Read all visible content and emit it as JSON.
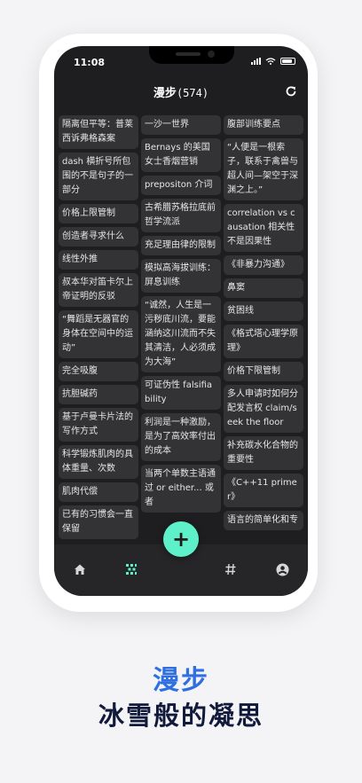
{
  "status": {
    "time": "11:08"
  },
  "header": {
    "title": "漫步",
    "count": "(574)"
  },
  "columns": [
    [
      "隔离但平等：普莱西诉弗格森案",
      "dash 横折号所包围的不是句子的一部分",
      "价格上限管制",
      "创造者寻求什么",
      "线性外推",
      "叔本华对笛卡尔上帝证明的反驳",
      "“舞蹈是无器官的身体在空间中的运动”",
      "完全吸腹",
      "抗胆碱药",
      "基于卢曼卡片法的写作方式",
      "科学锻炼肌肉的具体重量、次数",
      "肌肉代偿",
      "已有的习惯会一直保留"
    ],
    [
      "一沙一世界",
      "Bernays 的美国女士香烟营销",
      "prepositon 介词",
      "古希腊苏格拉底前哲学流派",
      "充足理由律的限制",
      "模拟高海拔训练：屏息训练",
      "“诚然，人生是一污秽底川流，要能涵纳这川流而不失其清洁，人必须成为大海”",
      "可证伪性 falsifiability",
      "利润是一种激励，是为了高效率付出的成本",
      "当两个单数主语通过 or either... 或者"
    ],
    [
      "腹部训练要点",
      "“人便是一根索子，联系于禽兽与超人间—架空于深渊之上。”",
      "correlation vs causation 相关性不是因果性",
      "《非暴力沟通》",
      "鼻窦",
      "贫困线",
      "《格式塔心理学原理》",
      "价格下限管制",
      "多人申请时如何分配发言权 claim/seek the floor",
      "补充碳水化合物的重要性",
      "《C++11 primer》",
      "语言的简单化和专"
    ]
  ],
  "tabs": [
    "home-icon",
    "random-icon",
    "hash-icon",
    "profile-icon"
  ],
  "fab": {
    "label": "+"
  },
  "caption": {
    "line1": "漫步",
    "line2": "冰雪般的凝思"
  },
  "colors": {
    "accent": "#5ef0c8",
    "caption_blue": "#2f6fe0",
    "caption_dark": "#111a3a"
  }
}
